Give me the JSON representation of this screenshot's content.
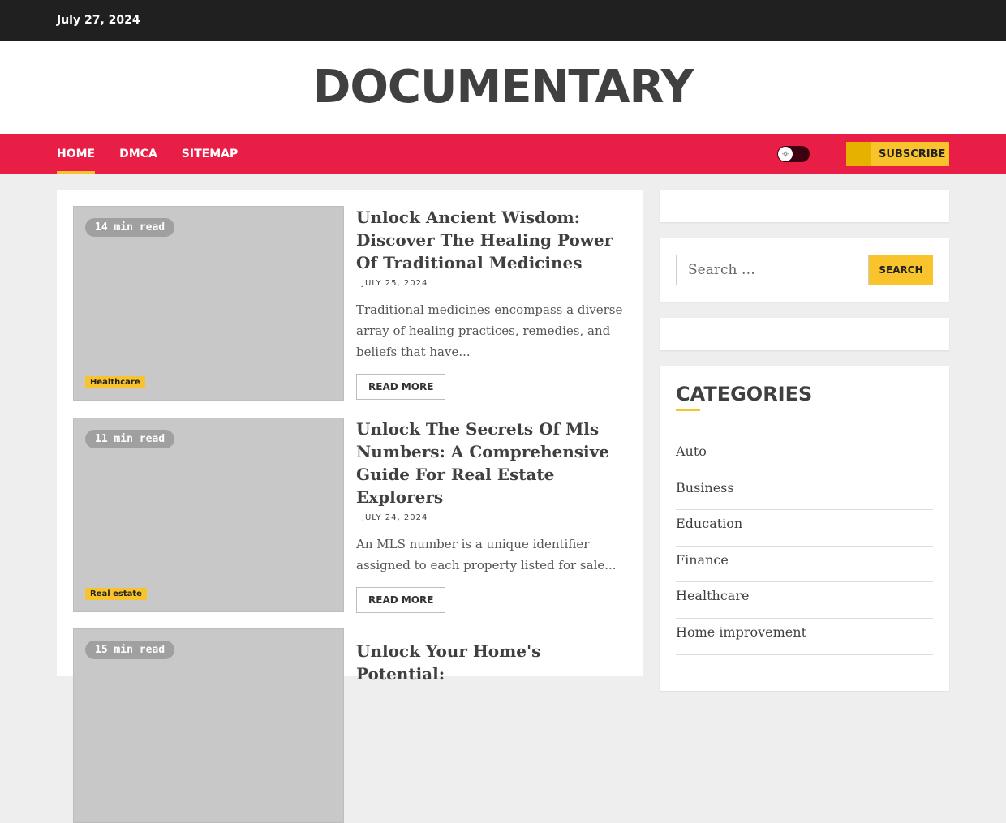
{
  "topbar": {
    "date": "July 27, 2024"
  },
  "site": {
    "title": "DOCUMENTARY"
  },
  "nav": {
    "items": [
      {
        "label": "HOME",
        "active": true
      },
      {
        "label": "DMCA",
        "active": false
      },
      {
        "label": "SITEMAP",
        "active": false
      }
    ],
    "subscribe_label": "SUBSCRIBE"
  },
  "posts": [
    {
      "read_time": "14 min read",
      "category": "Healthcare",
      "title": "Unlock Ancient Wisdom: Discover The Healing Power Of Traditional Medicines",
      "date": "JULY 25, 2024",
      "excerpt": "Traditional medicines encompass a diverse array of healing practices, remedies, and beliefs that have...",
      "read_more": "READ MORE"
    },
    {
      "read_time": "11 min read",
      "category": "Real estate",
      "title": "Unlock The Secrets Of Mls Numbers: A Comprehensive Guide For Real Estate Explorers",
      "date": "JULY 24, 2024",
      "excerpt": "An MLS number is a unique identifier assigned to each property listed for sale...",
      "read_more": "READ MORE"
    },
    {
      "read_time": "15 min read",
      "title": "Unlock Your Home's Potential:"
    }
  ],
  "search": {
    "placeholder": "Search …",
    "button_label": "SEARCH"
  },
  "categories": {
    "title": "CATEGORIES",
    "items": [
      "Auto",
      "Business",
      "Education",
      "Finance",
      "Healthcare",
      "Home improvement"
    ]
  },
  "colors": {
    "nav_bg": "#e91e46",
    "accent": "#f9c32c",
    "topbar_bg": "#202020"
  }
}
